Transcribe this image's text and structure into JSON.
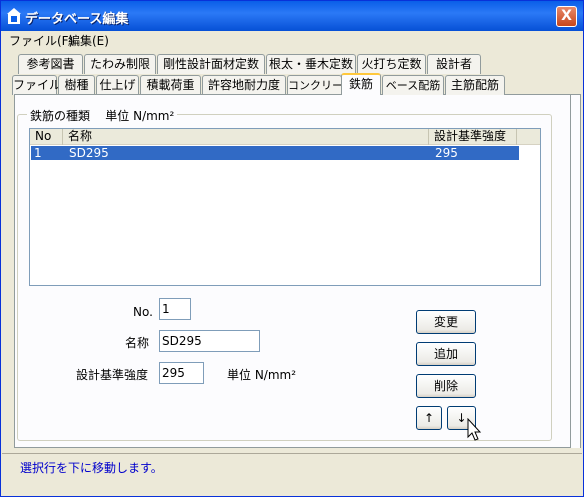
{
  "window": {
    "title": "データベース編集",
    "close_label": "X"
  },
  "menu": {
    "file": "ファイル(F)",
    "edit": "編集(E)"
  },
  "tabs_row1": [
    "参考図書",
    "たわみ制限",
    "剛性設計面材定数",
    "根太・垂木定数",
    "火打ち定数",
    "設計者"
  ],
  "tabs_row2": [
    "ファイル",
    "樹種",
    "仕上げ",
    "積載荷重",
    "許容地耐力度",
    "コンクリート",
    "鉄筋",
    "ベース配筋",
    "主筋配筋"
  ],
  "active_tab": "鉄筋",
  "group": {
    "title": "鉄筋の種類",
    "unit": "単位 N/mm²"
  },
  "list": {
    "columns": [
      "No",
      "名称",
      "設計基準強度"
    ],
    "rows": [
      {
        "no": "1",
        "name": "SD295",
        "strength": "295"
      }
    ]
  },
  "form": {
    "no_label": "No.",
    "no_value": "1",
    "name_label": "名称",
    "name_value": "SD295",
    "strength_label": "設計基準強度",
    "strength_value": "295",
    "unit": "単位 N/mm²"
  },
  "buttons": {
    "change": "変更",
    "add": "追加",
    "delete": "削除",
    "up": "↑",
    "down": "↓"
  },
  "status": "選択行を下に移動します。"
}
